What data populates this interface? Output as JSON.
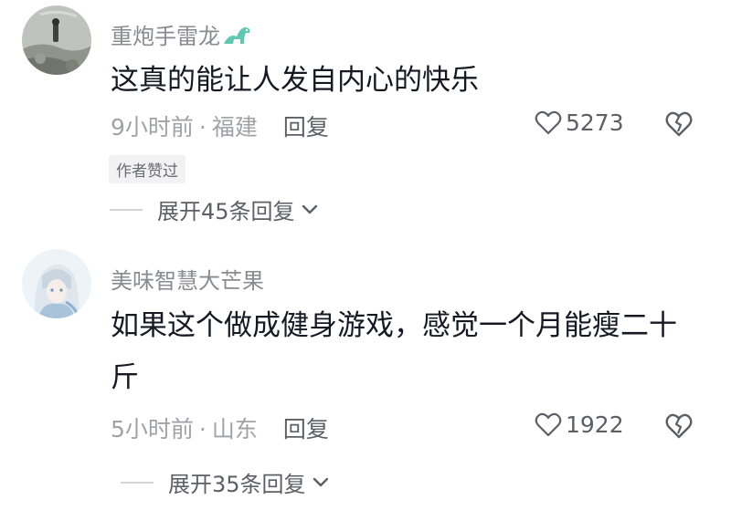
{
  "comments": [
    {
      "username": "重炮手雷龙",
      "text": "这真的能让人发自内心的快乐",
      "time": "9小时前",
      "location": "福建",
      "reply_label": "回复",
      "likes": "5273",
      "badge": "作者赞过",
      "expand_label": "展开45条回复"
    },
    {
      "username": "美味智慧大芒果",
      "text": "如果这个做成健身游戏，感觉一个月能瘦二十斤",
      "time": "5小时前",
      "location": "山东",
      "reply_label": "回复",
      "likes": "1922",
      "expand_label": "展开35条回复"
    }
  ],
  "separator": "·",
  "icons": {
    "like": "heart-outline-icon",
    "dislike": "broken-heart-icon",
    "expand": "chevron-down-icon",
    "username_badge": "dinosaur-icon"
  },
  "colors": {
    "username": "#8a8b91",
    "text": "#161823",
    "meta": "#a1a2a7",
    "action": "#5e5f66",
    "dino": "#5fc8b0"
  }
}
